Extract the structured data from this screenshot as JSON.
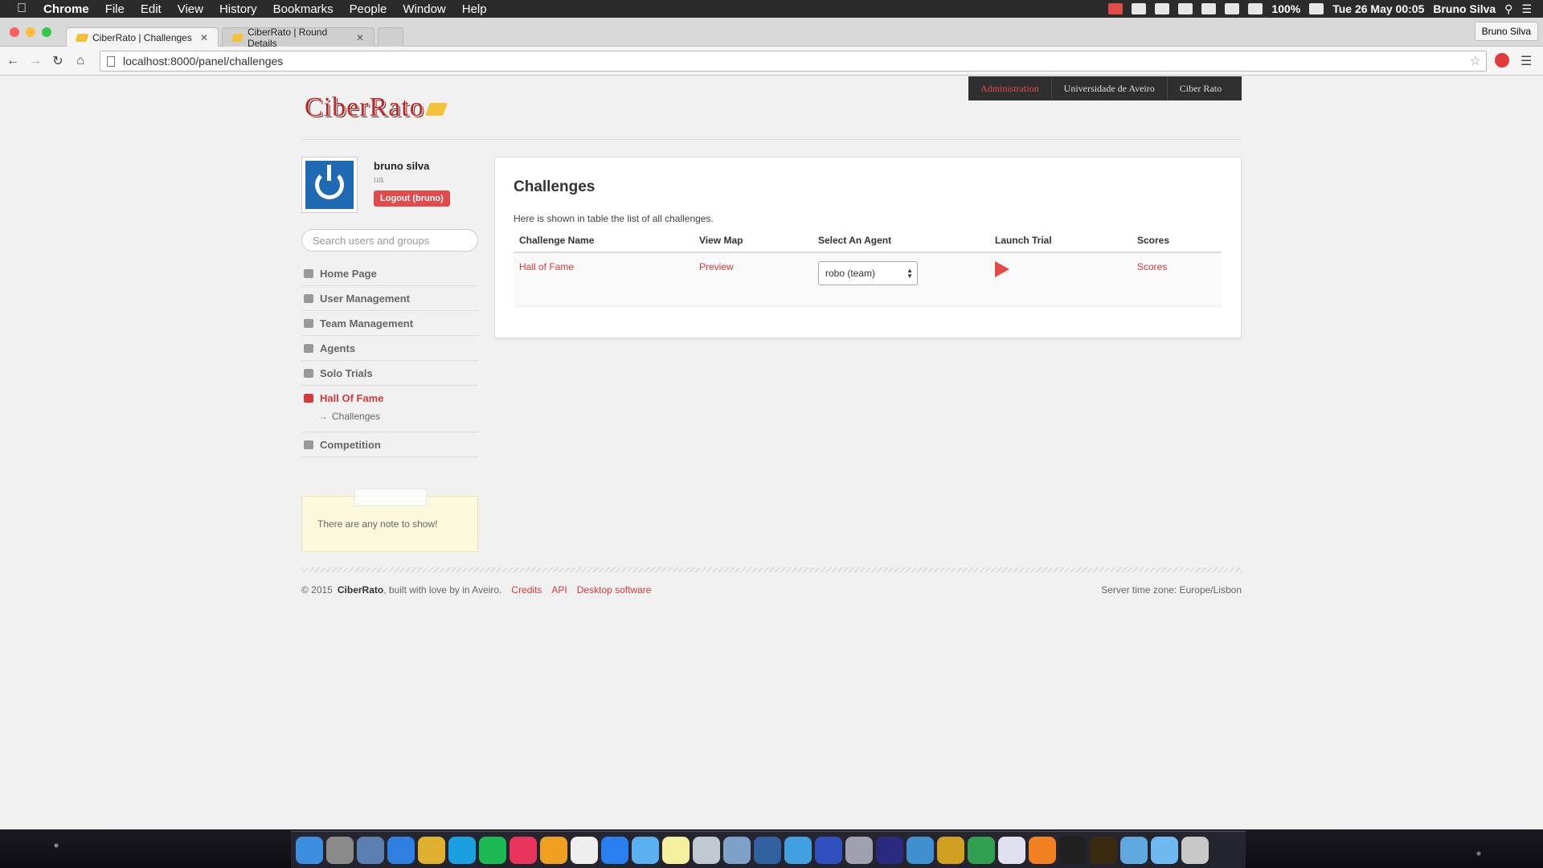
{
  "menubar": {
    "app_name": "Chrome",
    "items": [
      "File",
      "Edit",
      "View",
      "History",
      "Bookmarks",
      "People",
      "Window",
      "Help"
    ],
    "battery": "100%",
    "datetime": "Tue 26 May  00:05",
    "user": "Bruno Silva"
  },
  "browser": {
    "tabs": [
      {
        "title": "CiberRato | Challenges"
      },
      {
        "title": "CiberRato | Round Details"
      }
    ],
    "profile_name": "Bruno Silva",
    "url": "localhost:8000/panel/challenges"
  },
  "site": {
    "logo_text": "CiberRato",
    "topnav": [
      "Administration",
      "Universidade de Aveiro",
      "Ciber Rato"
    ]
  },
  "user": {
    "name": "bruno silva",
    "org": "ua",
    "logout_label": "Logout (bruno)"
  },
  "sidebar": {
    "search_placeholder": "Search users and groups",
    "items": [
      {
        "label": "Home Page",
        "icon": "home-icon"
      },
      {
        "label": "User Management",
        "icon": "user-icon"
      },
      {
        "label": "Team Management",
        "icon": "users-icon"
      },
      {
        "label": "Agents",
        "icon": "eye-icon"
      },
      {
        "label": "Solo Trials",
        "icon": "lock-icon"
      },
      {
        "label": "Hall Of Fame",
        "icon": "flag-icon"
      }
    ],
    "sub_item": "Challenges",
    "last_item": {
      "label": "Competition",
      "icon": "trophy-icon"
    },
    "notes_text": "There are any note to show!"
  },
  "main": {
    "title": "Challenges",
    "description": "Here is shown in table the list of all challenges.",
    "columns": [
      "Challenge Name",
      "View Map",
      "Select An Agent",
      "Launch Trial",
      "Scores"
    ],
    "rows": [
      {
        "challenge": "Hall of Fame",
        "view_map": "Preview",
        "agent": "robo (team)",
        "scores": "Scores"
      }
    ]
  },
  "footer": {
    "copyright": "© 2015",
    "brand": "CiberRato",
    "tagline": ", built with love by in Aveiro.",
    "links": [
      "Credits",
      "API",
      "Desktop software"
    ],
    "timezone": "Server time zone: Europe/Lisbon"
  },
  "colors": {
    "accent": "#e34b4b",
    "link": "#d63b3b",
    "topnav_bg": "#2f2f2f",
    "avatar_bg": "#1f6ab3"
  }
}
